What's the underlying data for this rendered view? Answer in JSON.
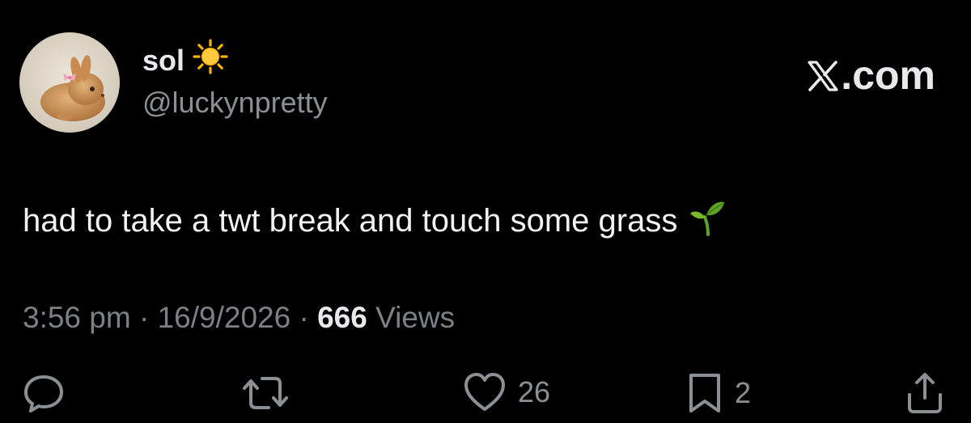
{
  "author": {
    "display_name": "sol",
    "handle": "@luckynpretty",
    "name_emoji": "sun-icon",
    "avatar": "bunny-photo"
  },
  "brand": {
    "logo_text": "X",
    "suffix": ".com"
  },
  "tweet": {
    "text": "had to take a twt break and touch some grass",
    "trailing_emoji": "seedling-icon"
  },
  "meta": {
    "time": "3:56 pm",
    "sep1": "·",
    "date": "16/9/2026",
    "sep2": "·",
    "views_count": "666",
    "views_label": "Views"
  },
  "actions": {
    "reply": {
      "icon": "reply-icon",
      "count": ""
    },
    "retweet": {
      "icon": "retweet-icon",
      "count": ""
    },
    "like": {
      "icon": "heart-icon",
      "count": "26"
    },
    "bookmark": {
      "icon": "bookmark-icon",
      "count": "2"
    },
    "share": {
      "icon": "share-icon",
      "count": ""
    }
  },
  "colors": {
    "background": "#000000",
    "primary_text": "#e7e9ea",
    "secondary_text": "#8b9095"
  }
}
